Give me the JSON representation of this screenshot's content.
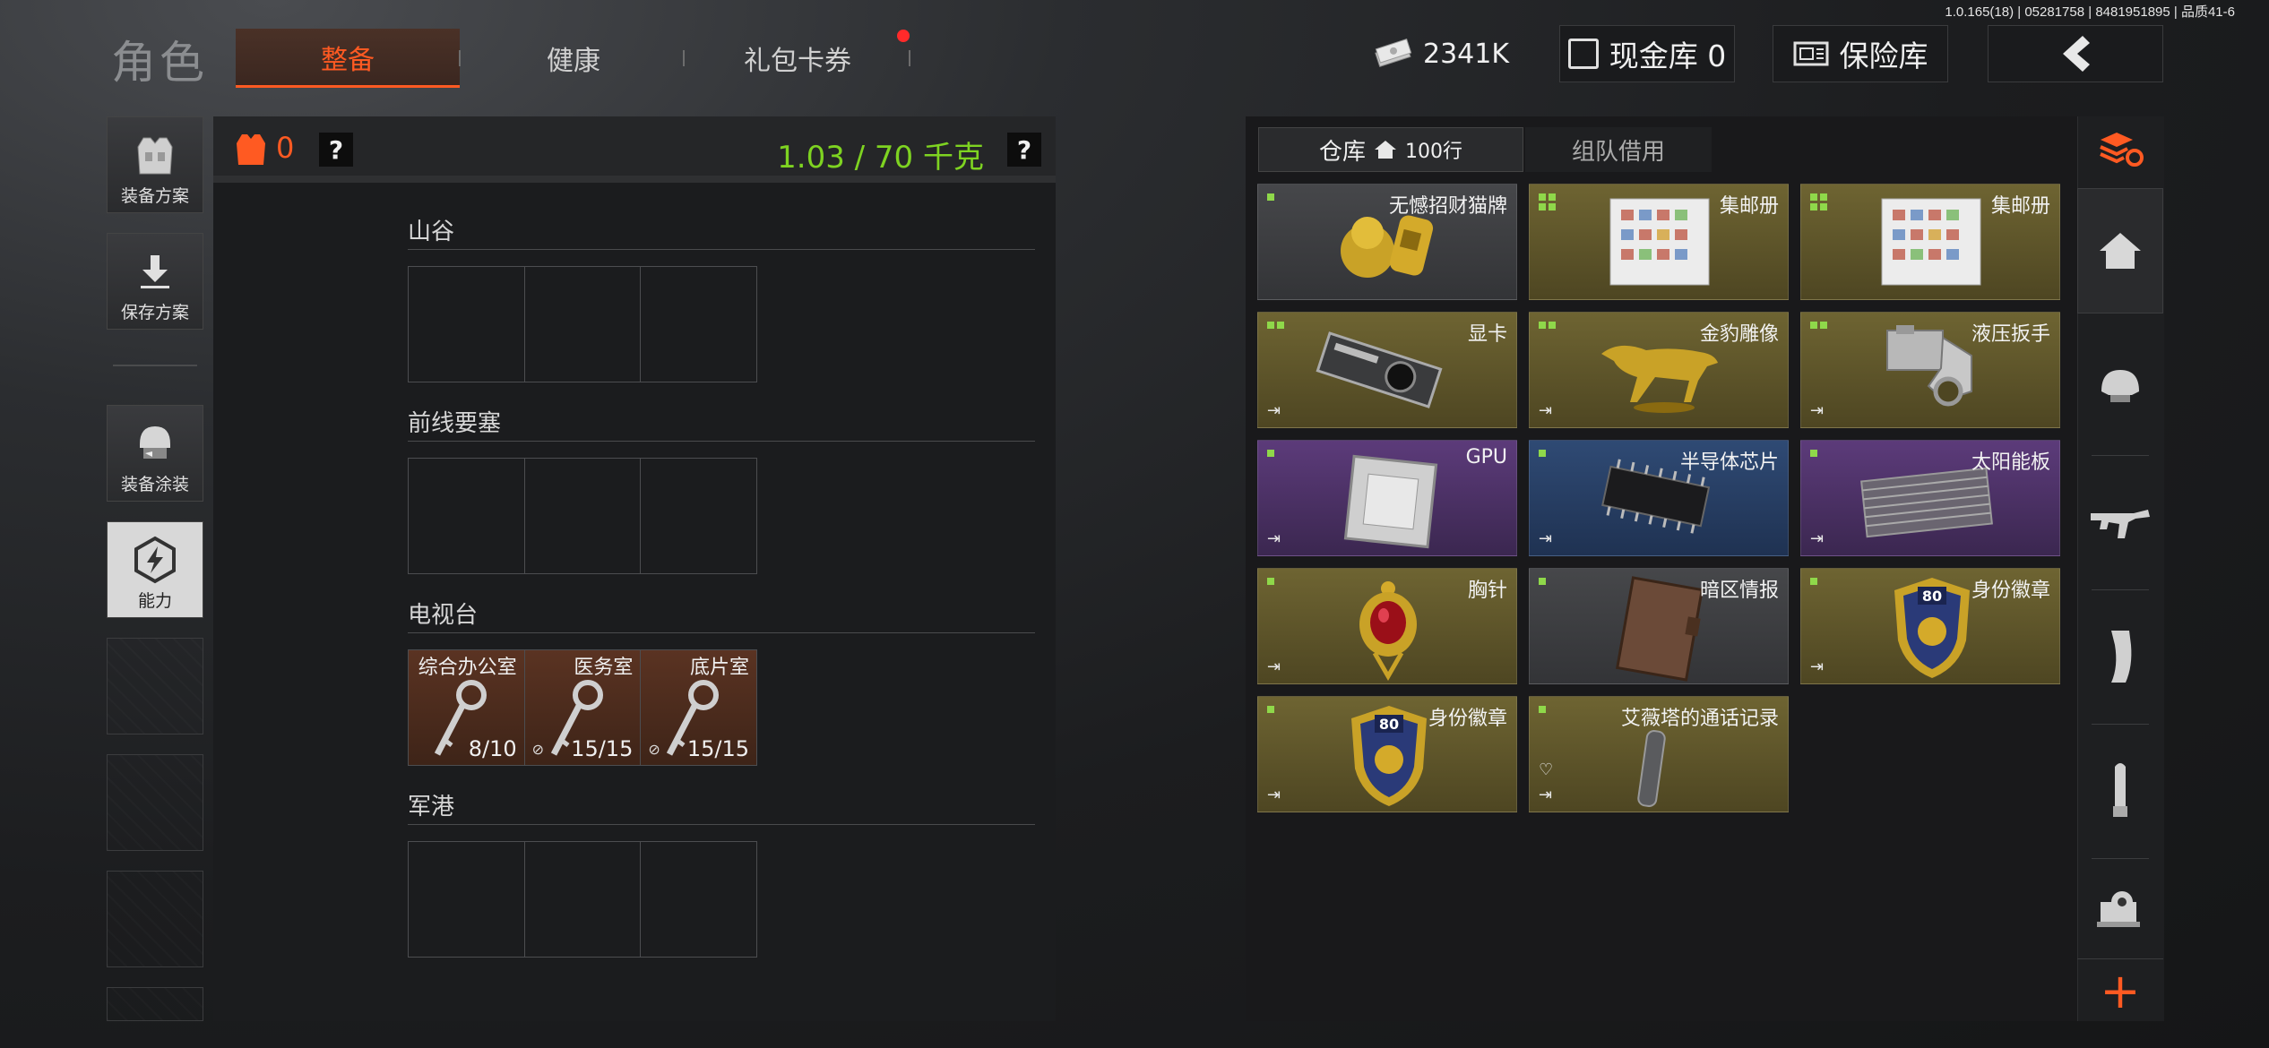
{
  "version": "1.0.165(18) | 05281758 | 8481951895 | 品质41-6",
  "header": {
    "title": "角色",
    "tabs": [
      {
        "label": "整备",
        "active": true
      },
      {
        "label": "健康",
        "active": false
      },
      {
        "label": "礼包卡券",
        "active": false,
        "badge": true
      }
    ],
    "money": "2341K",
    "cash_vault": "现金库 0",
    "insurance": "保险库"
  },
  "sidebar": {
    "buttons": [
      {
        "label": "装备方案",
        "icon": "vest-icon"
      },
      {
        "label": "保存方案",
        "icon": "download-icon"
      },
      {
        "label": "装备涂装",
        "icon": "helmet-icon"
      },
      {
        "label": "能力",
        "icon": "ability-icon",
        "active": true
      }
    ]
  },
  "loadout": {
    "armor_count": "0",
    "help": "?",
    "weight": "1.03 / 70 千克",
    "sections": [
      {
        "title": "山谷",
        "slots": []
      },
      {
        "title": "前线要塞",
        "slots": []
      },
      {
        "title": "电视台",
        "slots": [
          {
            "label": "综合办公室",
            "count": "8/10"
          },
          {
            "label": "医务室",
            "count": "15/15"
          },
          {
            "label": "底片室",
            "count": "15/15"
          }
        ]
      },
      {
        "title": "军港",
        "slots": []
      }
    ]
  },
  "inventory": {
    "tab_warehouse": "仓库",
    "rows": "100行",
    "tab_team": "组队借用",
    "items": [
      {
        "name": "无憾招财猫牌",
        "rarity": "gray"
      },
      {
        "name": "集邮册",
        "rarity": "gold"
      },
      {
        "name": "集邮册",
        "rarity": "gold"
      },
      {
        "name": "显卡",
        "rarity": "gold"
      },
      {
        "name": "金豹雕像",
        "rarity": "gold"
      },
      {
        "name": "液压扳手",
        "rarity": "gold"
      },
      {
        "name": "GPU",
        "rarity": "purple"
      },
      {
        "name": "半导体芯片",
        "rarity": "blue"
      },
      {
        "name": "太阳能板",
        "rarity": "purple"
      },
      {
        "name": "胸针",
        "rarity": "gold"
      },
      {
        "name": "暗区情报",
        "rarity": "gray"
      },
      {
        "name": "身份徽章",
        "rarity": "gold"
      },
      {
        "name": "身份徽章",
        "rarity": "gold"
      },
      {
        "name": "艾薇塔的通话记录",
        "rarity": "gold"
      }
    ],
    "badge_number": "80"
  },
  "colors": {
    "accent": "#ff5a22",
    "weight_green": "#7ed321",
    "gold_item": "#6e6432",
    "purple_item": "#5c3b7a",
    "blue_item": "#2f4a74"
  }
}
